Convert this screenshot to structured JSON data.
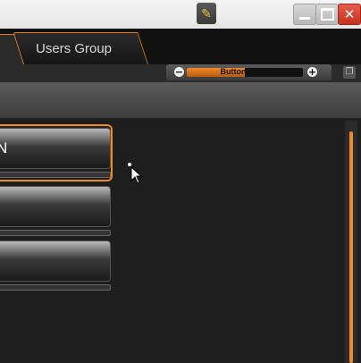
{
  "title_bar": {
    "icons": [
      "pencil-icon",
      "minimize-icon",
      "maximize-icon",
      "close-icon"
    ],
    "close_glyph": "✕"
  },
  "tabs": [
    {
      "label": ""
    },
    {
      "label": "Users Group"
    }
  ],
  "scale_control": {
    "label": "Button Scale",
    "minus": "−",
    "plus": "+",
    "level": 0.5
  },
  "buttons": [
    {
      "label": "N",
      "selected": true
    },
    {
      "label": "",
      "selected": false
    },
    {
      "label": "",
      "selected": false
    }
  ],
  "colors": {
    "accent": "#f08a28",
    "close": "#c2321f",
    "background": "#1e1e1e"
  }
}
